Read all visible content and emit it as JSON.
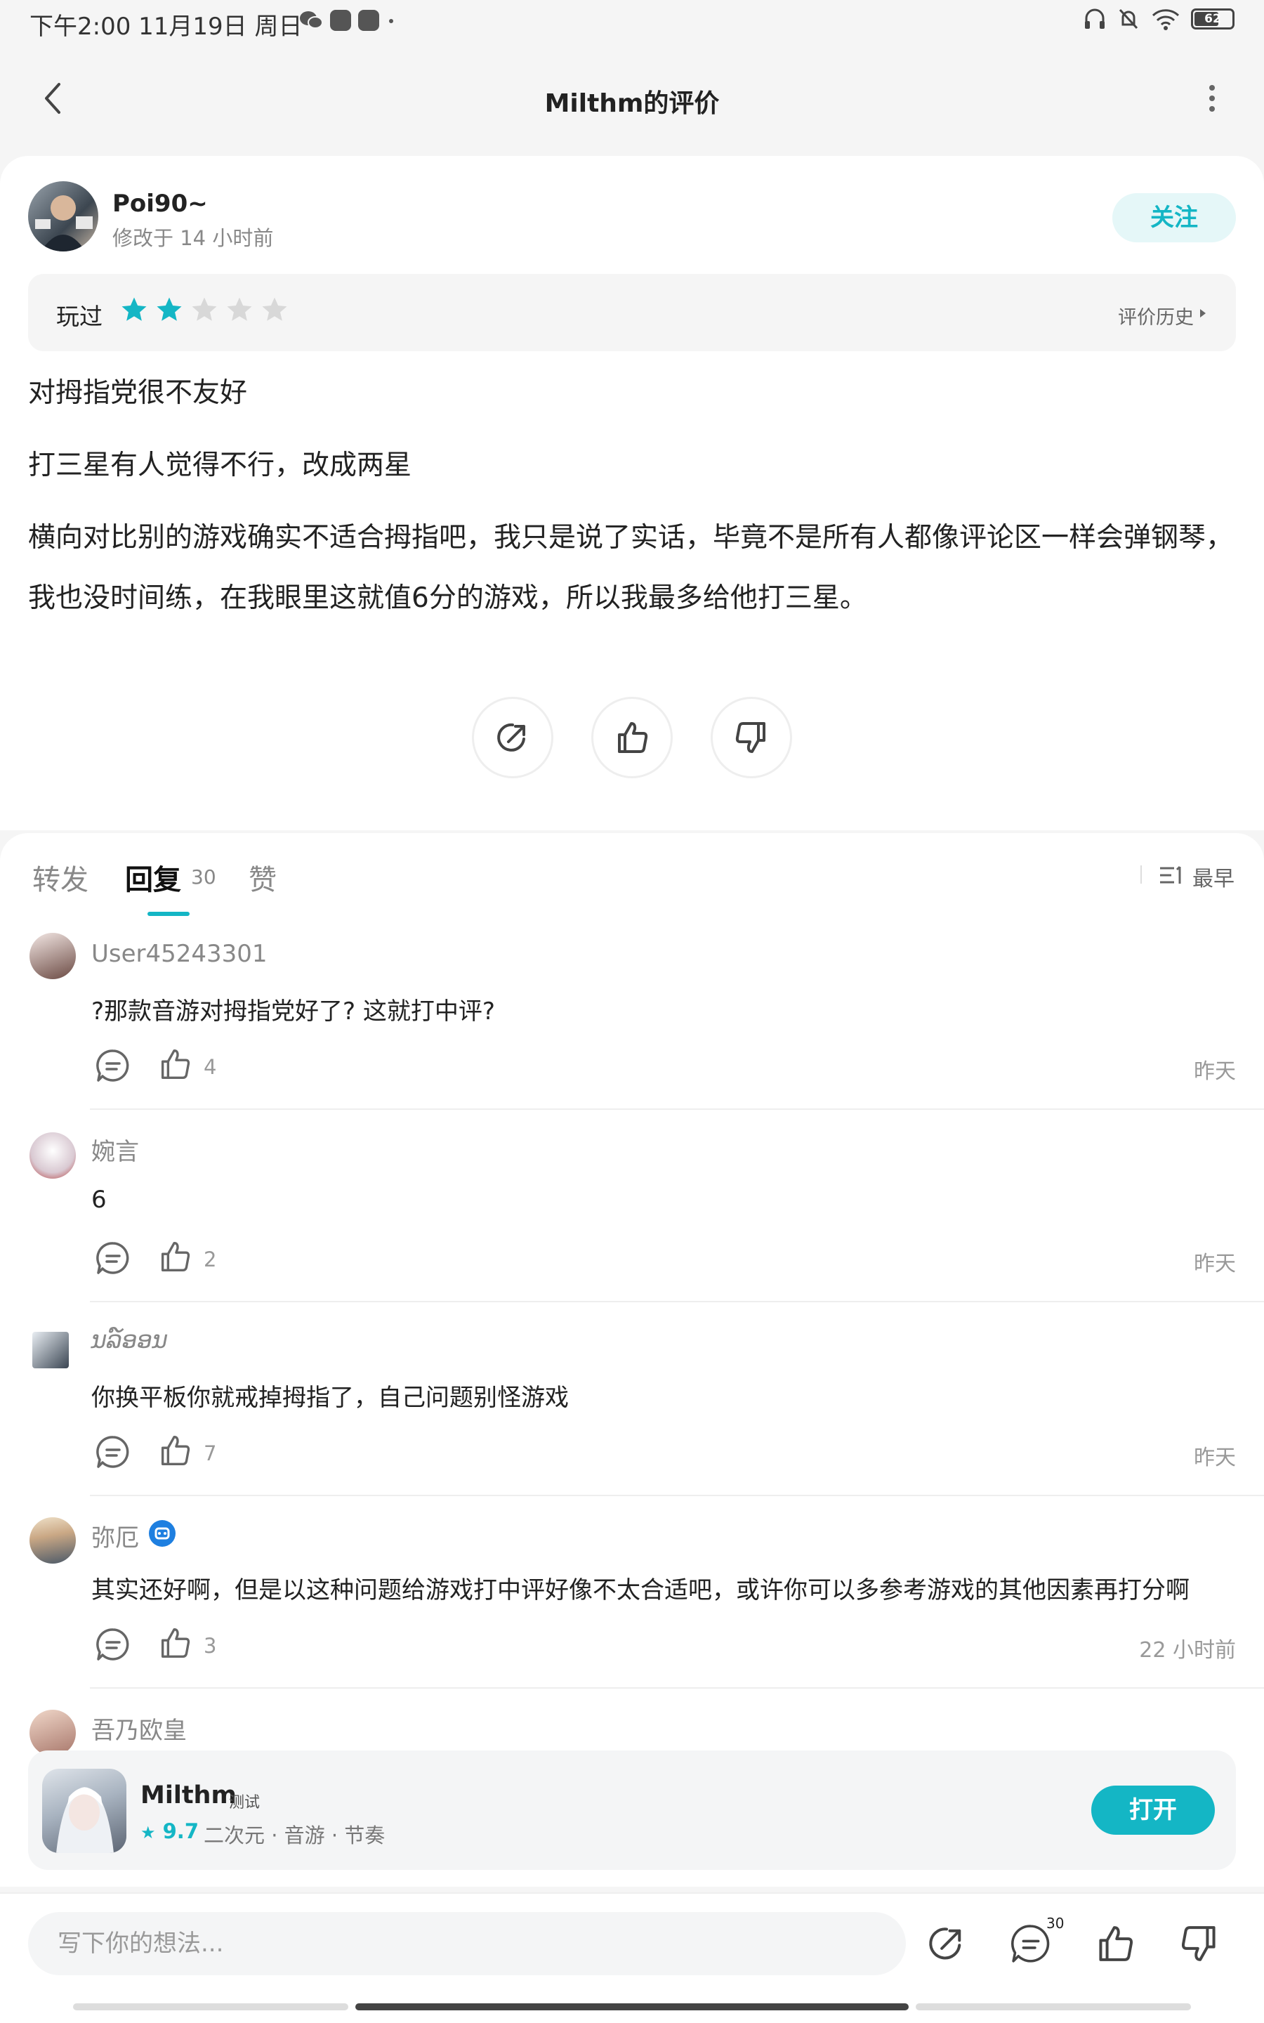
{
  "status_bar": {
    "time_text": "下午2:00 11月19日 周日",
    "battery": "62"
  },
  "header": {
    "title": "Milthm的评价"
  },
  "review": {
    "user_name": "Poi90~",
    "edited_time": "修改于 14 小时前",
    "follow_label": "关注",
    "played_label": "玩过",
    "stars_filled": 2,
    "stars_total": 5,
    "history_label": "评价历史",
    "paragraphs": [
      "对拇指党很不友好",
      "打三星有人觉得不行，改成两星",
      "横向对比别的游戏确实不适合拇指吧，我只是说了实话，毕竟不是所有人都像评论区一样会弹钢琴，我也没时间练，在我眼里这就值6分的游戏，所以我最多给他打三星。"
    ]
  },
  "tabs": {
    "forward": "转发",
    "reply": "回复",
    "reply_count": "30",
    "like": "赞",
    "sort_label": "最早"
  },
  "comments": [
    {
      "name": "User45243301",
      "text": "?那款音游对拇指党好了? 这就打中评?",
      "likes": "4",
      "time": "昨天"
    },
    {
      "name": "婉言",
      "text": "6",
      "likes": "2",
      "time": "昨天"
    },
    {
      "name": "ນລ໌ອອນ",
      "text": "你换平板你就戒掉拇指了，自己问题别怪游戏",
      "likes": "7",
      "time": "昨天"
    },
    {
      "name": "弥厄",
      "text": "其实还好啊，但是以这种问题给游戏打中评好像不太合适吧，或许你可以多参考游戏的其他因素再打分啊",
      "likes": "3",
      "time": "22 小时前"
    },
    {
      "name": "吾乃欧皇"
    }
  ],
  "promo": {
    "app_name": "Milthm",
    "tag": "测试",
    "rating": "9.7",
    "categories": "二次元 · 音游 · 节奏",
    "open_label": "打开"
  },
  "bottom_bar": {
    "input_placeholder": "写下你的想法...",
    "comment_badge": "30"
  },
  "colors": {
    "accent": "#14b6c5",
    "star_filled": "#14b6c5",
    "star_empty": "#d8d8d8"
  }
}
